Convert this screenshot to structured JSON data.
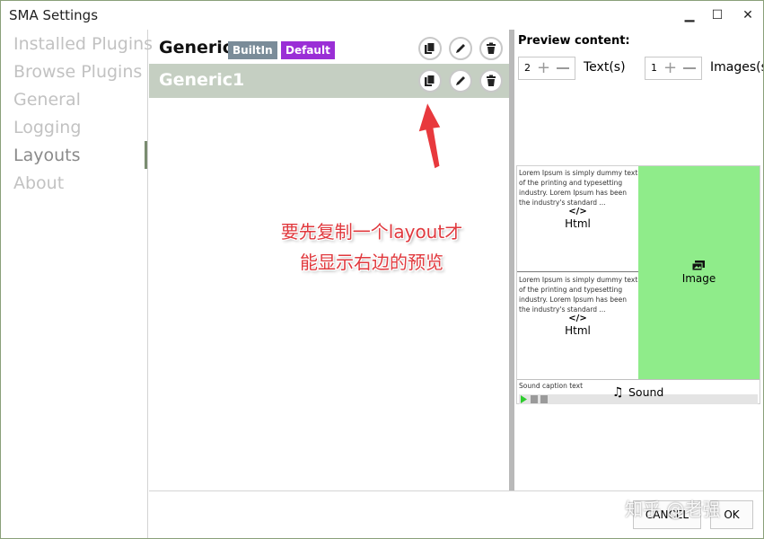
{
  "window": {
    "title": "SMA Settings",
    "minimize": "▁",
    "maximize": "☐",
    "close": "✕"
  },
  "sidebar": {
    "items": [
      {
        "label": "Installed Plugins"
      },
      {
        "label": "Browse Plugins"
      },
      {
        "label": "General"
      },
      {
        "label": "Logging"
      },
      {
        "label": "Layouts",
        "active": true
      },
      {
        "label": "About"
      }
    ]
  },
  "layouts": {
    "rows": [
      {
        "name": "Generic",
        "badges": [
          {
            "label": "BuiltIn",
            "color": "#7a8c99"
          },
          {
            "label": "Default",
            "color": "#9a2fd6"
          }
        ]
      },
      {
        "name": "Generic1",
        "selected": true
      }
    ]
  },
  "preview": {
    "title": "Preview content:",
    "texts": {
      "value": "2",
      "label": "Text(s)"
    },
    "images": {
      "value": "1",
      "label": "Images(s"
    },
    "html1": {
      "lorem": "Lorem Ipsum is simply dummy text of the printing and typesetting industry. Lorem Ipsum has been the industry's standard ...",
      "icon": "</>",
      "label": "Html"
    },
    "html2": {
      "lorem": "Lorem Ipsum is simply dummy text of the printing and typesetting industry. Lorem Ipsum has been the industry's standard ...",
      "icon": "</>",
      "label": "Html"
    },
    "image": {
      "label": "Image",
      "color": "#8fec8a"
    },
    "sound": {
      "caption": "Sound caption text",
      "label": "Sound"
    }
  },
  "footer": {
    "cancel": "CANCEL",
    "ok": "OK"
  },
  "annotation": {
    "line1": "要先复制一个layout才",
    "line2": "能显示右边的预览"
  },
  "watermark": "知乎 @老强"
}
